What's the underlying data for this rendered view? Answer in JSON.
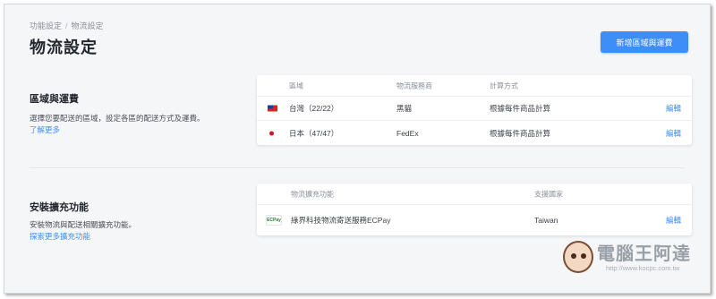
{
  "breadcrumb": {
    "parent": "功能設定",
    "separator": "/",
    "current": "物流設定"
  },
  "page_title": "物流設定",
  "add_button_label": "新增區域與運費",
  "regions": {
    "title": "區域與運費",
    "description": "選擇您要配送的區域，設定各區的配送方式及運費。",
    "learn_more": "了解更多",
    "columns": [
      "區域",
      "物流服務商",
      "計算方式"
    ],
    "rows": [
      {
        "flag": "taiwan-flag",
        "region": "台灣（22/22）",
        "provider": "黑貓",
        "method": "根據每件商品計算",
        "edit": "編輯"
      },
      {
        "flag": "japan-flag",
        "region": "日本（47/47）",
        "provider": "FedEx",
        "method": "根據每件商品計算",
        "edit": "編輯"
      }
    ]
  },
  "extensions": {
    "title": "安裝擴充功能",
    "description": "安裝物流與配送相關擴充功能。",
    "explore_link": "探索更多擴充功能",
    "columns": [
      "物流擴充功能",
      "支援國家"
    ],
    "rows": [
      {
        "logo": "ECPay",
        "name": "綠界科技物流寄送服務ECPay",
        "country": "Taiwan",
        "edit": "編輯"
      }
    ]
  },
  "watermark": {
    "text": "電腦王阿達",
    "url": "http://www.kocpc.com.tw"
  }
}
